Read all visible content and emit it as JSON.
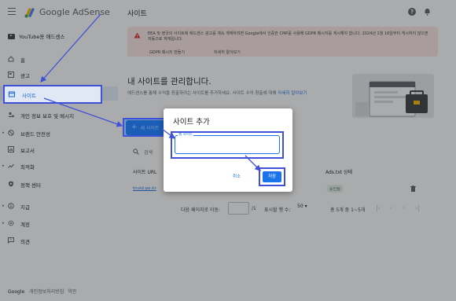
{
  "app": {
    "brand": "Google AdSense",
    "page_title": "사이트",
    "account": "YouTube용 애드센스"
  },
  "sidebar": {
    "items": [
      {
        "label": "홈"
      },
      {
        "label": "광고"
      },
      {
        "label": "사이트"
      },
      {
        "label": "개인 정보 보호 및 메시지"
      },
      {
        "label": "브랜드 안전성"
      },
      {
        "label": "보고서"
      },
      {
        "label": "최적화"
      },
      {
        "label": "정책 센터"
      },
      {
        "label": "지급"
      },
      {
        "label": "계정"
      },
      {
        "label": "의견"
      }
    ],
    "footer": {
      "google": "Google",
      "privacy": "개인정보처리방침",
      "terms": "약관"
    }
  },
  "alert": {
    "text": "EEA 및 영국의 사이트에 애드센스 광고를 계속 게재하려면 Google에서 인증한 CMP를 사용해 GDPR 메시지를 게시해야 합니다. 2024년 1월 16일부터 게시하지 않으면 자동으로 게재됩니다.",
    "action1": "GDPR 메시지 만들기",
    "action2": "자세히 알아보기"
  },
  "main": {
    "section_title": "내 사이트를 관리합니다.",
    "section_desc": "애드센스를 통해 수익을 창출하려는 사이트를 추가하세요. 사이트 수익 창출에 대해",
    "section_desc_link": "자세히 알아보기",
    "add_button": "새 사이트",
    "search_label": "검색",
    "columns": [
      "사이트 URL",
      "Ads.txt 상태"
    ],
    "rows": [
      {
        "url": "tnvid.pe.kr",
        "status": "승인됨"
      }
    ],
    "pager": {
      "label": "다음 페이지로 이동:",
      "page_of": "/1",
      "rows_label": "표시할 행 수:",
      "rows_value": "50",
      "range": "총 5개 중 1~5개"
    }
  },
  "dialog": {
    "title": "사이트 추가",
    "field_label": "웹 사이트",
    "field_value": "",
    "cancel": "취소",
    "save": "저장"
  },
  "colors": {
    "accent": "#1a73e8",
    "annotation": "#3f51d8",
    "alert_bg": "#fce8e6"
  }
}
